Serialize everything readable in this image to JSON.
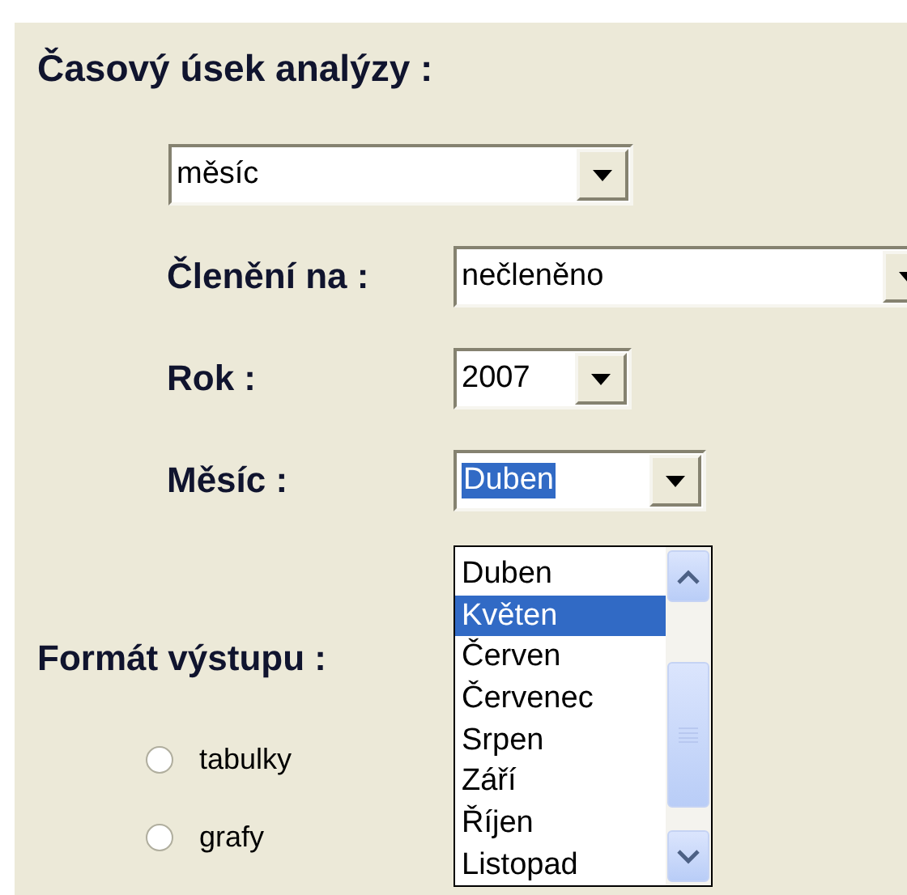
{
  "heading": "Časový úsek analýzy :",
  "period": {
    "value": "měsíc"
  },
  "fields": [
    {
      "label": "Členění na :",
      "value": "nečleněno",
      "focused": false
    },
    {
      "label": "Rok :",
      "value": "2007",
      "focused": false
    },
    {
      "label": "Měsíc :",
      "value": "Duben",
      "focused": true
    }
  ],
  "dropdown": {
    "items": [
      {
        "label": "Duben",
        "selected": false
      },
      {
        "label": "Květen",
        "selected": true
      },
      {
        "label": "Červen",
        "selected": false
      },
      {
        "label": "Červenec",
        "selected": false
      },
      {
        "label": "Srpen",
        "selected": false
      },
      {
        "label": "Září",
        "selected": false
      },
      {
        "label": "Říjen",
        "selected": false
      },
      {
        "label": "Listopad",
        "selected": false
      }
    ]
  },
  "output": {
    "heading": "Formát výstupu :",
    "options": [
      {
        "label": "tabulky",
        "selected": false
      },
      {
        "label": "grafy",
        "selected": false
      }
    ]
  }
}
